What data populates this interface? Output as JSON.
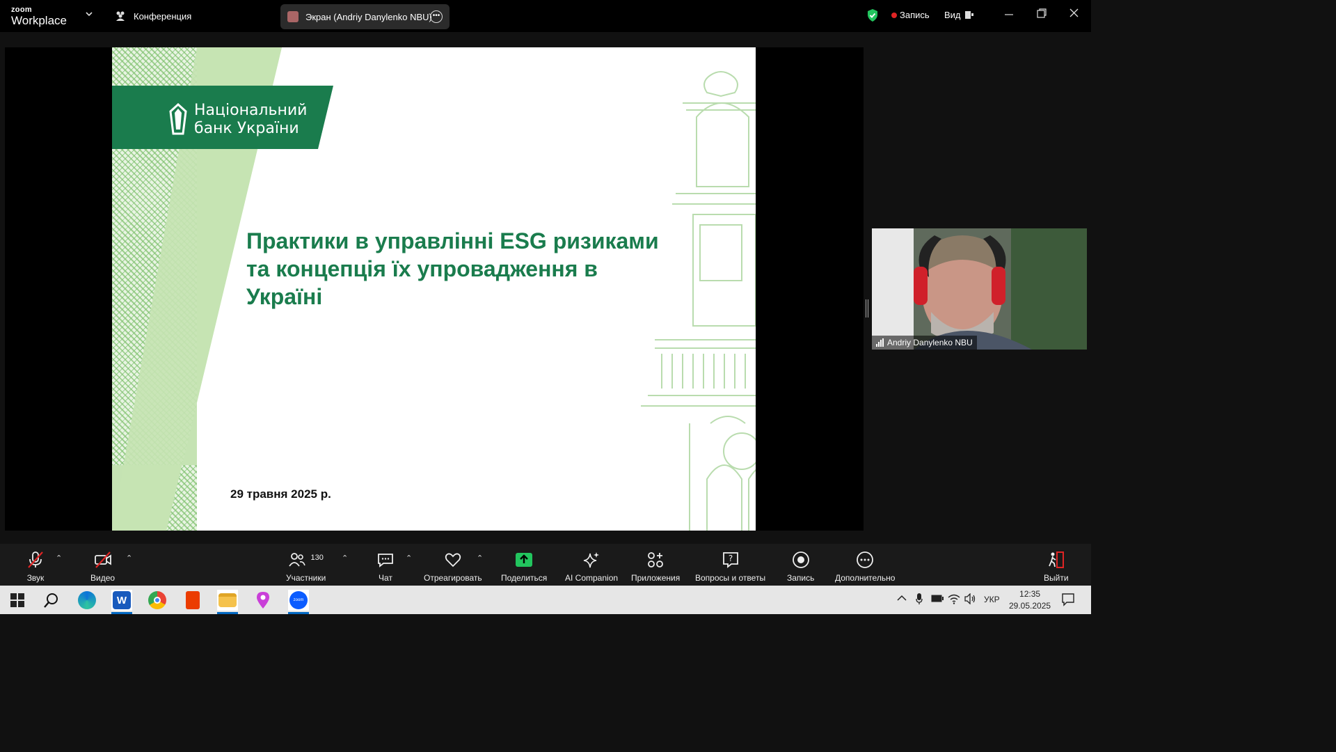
{
  "topbar": {
    "logo_top": "zoom",
    "logo_bottom": "Workplace",
    "meeting_label": "Конференция",
    "screen_share_label": "Экран (Andriy Danylenko NBU)",
    "recording_label": "Запись",
    "view_label": "Вид"
  },
  "slide": {
    "logo_line1": "Національний",
    "logo_line2": "банк України",
    "title_line1": "Практики в управлінні ESG ризиками",
    "title_line2": "та концепція їх упровадження в",
    "title_line3": "Україні",
    "date": "29 травня 2025 р.",
    "brand_green": "#1a7c4d"
  },
  "video": {
    "participant_name": "Andriy Danylenko NBU"
  },
  "toolbar": {
    "audio": "Звук",
    "video": "Видео",
    "participants": "Участники",
    "participants_count": "130",
    "chat": "Чат",
    "react": "Отреагировать",
    "share": "Поделиться",
    "ai": "AI Companion",
    "apps": "Приложения",
    "qa": "Вопросы и ответы",
    "record": "Запись",
    "more": "Дополнительно",
    "leave": "Выйти",
    "share_color": "#22c55e",
    "leave_color": "#e02424"
  },
  "taskbar": {
    "language": "УКР",
    "time": "12:35",
    "date": "29.05.2025"
  }
}
